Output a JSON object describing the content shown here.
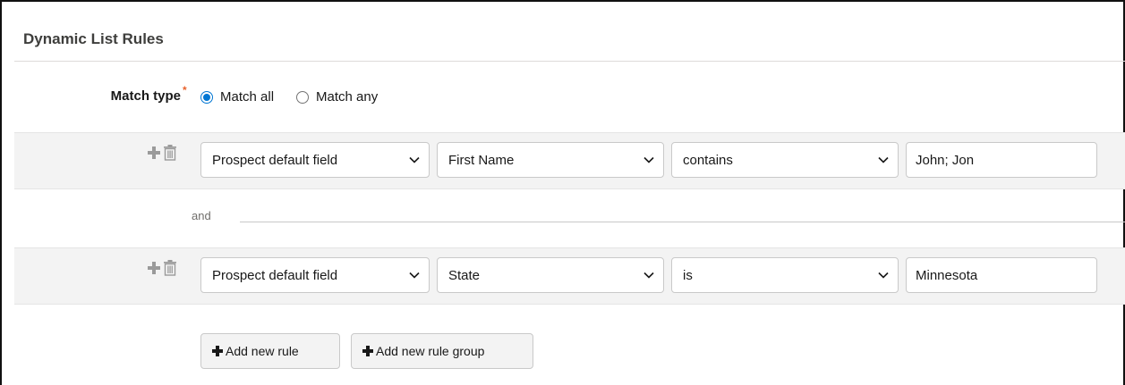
{
  "section": {
    "title": "Dynamic List Rules"
  },
  "match": {
    "label": "Match type",
    "required_marker": "*",
    "options": [
      {
        "label": "Match all",
        "checked": true
      },
      {
        "label": "Match any",
        "checked": false
      }
    ]
  },
  "rules": [
    {
      "field_type": "Prospect default field",
      "field": "First Name",
      "operator": "contains",
      "value": "John; Jon"
    },
    {
      "field_type": "Prospect default field",
      "field": "State",
      "operator": "is",
      "value": "Minnesota"
    }
  ],
  "connector": "and",
  "buttons": {
    "add_rule": "Add new rule",
    "add_group": "Add new rule group"
  },
  "icons": {
    "add": "plus-icon",
    "delete": "trash-icon",
    "dropdown": "chevron-down-icon"
  },
  "colors": {
    "accent": "#0176d3",
    "required": "#e8622d",
    "row_background": "#f3f3f3"
  }
}
